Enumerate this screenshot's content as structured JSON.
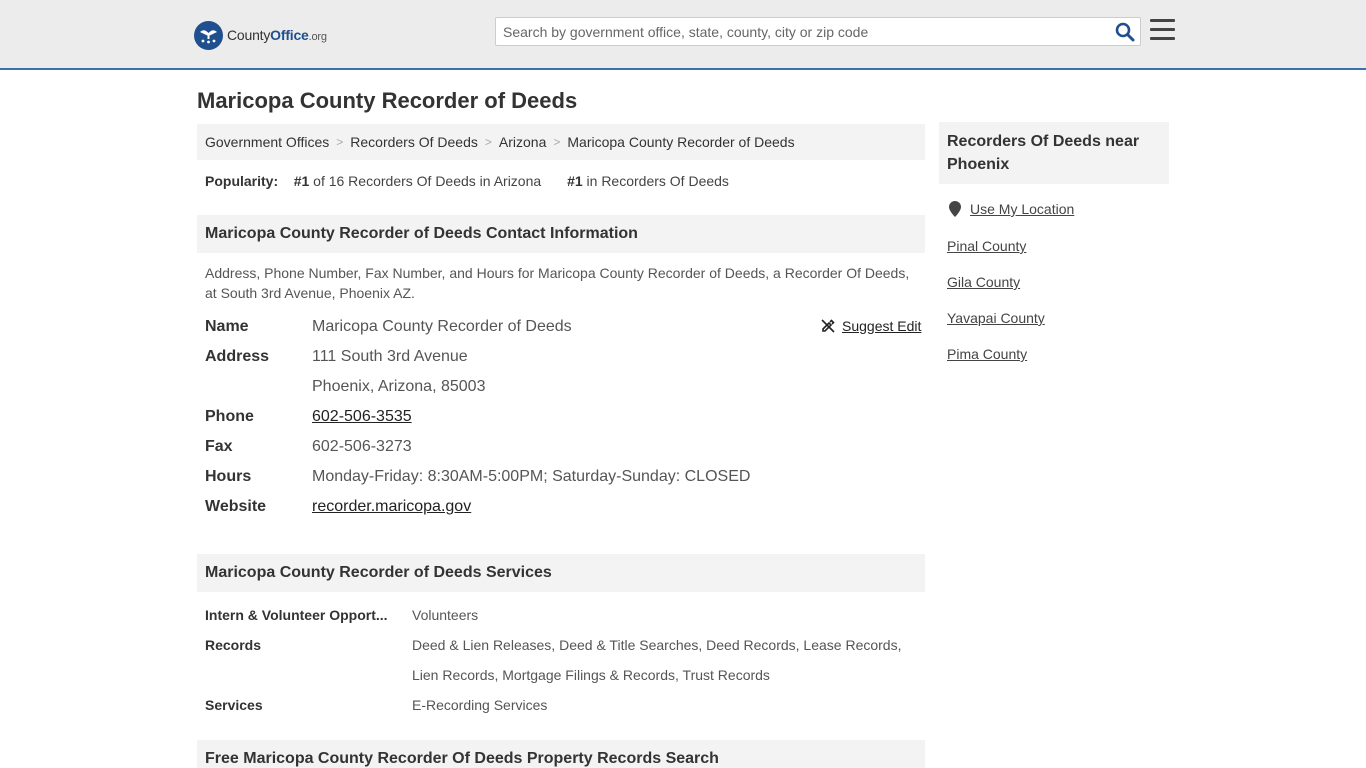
{
  "header": {
    "logo_county": "County",
    "logo_office": "Office",
    "logo_org": ".org",
    "search_placeholder": "Search by government office, state, county, city or zip code"
  },
  "page": {
    "title": "Maricopa County Recorder of Deeds",
    "breadcrumb": [
      "Government Offices",
      "Recorders Of Deeds",
      "Arizona",
      "Maricopa County Recorder of Deeds"
    ],
    "popularity_label": "Popularity:",
    "pop1_rank": "#1",
    "pop1_text": "of 16 Recorders Of Deeds in Arizona",
    "pop2_rank": "#1",
    "pop2_text": "in Recorders Of Deeds"
  },
  "contact": {
    "heading": "Maricopa County Recorder of Deeds Contact Information",
    "description": "Address, Phone Number, Fax Number, and Hours for Maricopa County Recorder of Deeds, a Recorder Of Deeds, at South 3rd Avenue, Phoenix AZ.",
    "suggest_edit": "Suggest Edit",
    "name_label": "Name",
    "name_value": "Maricopa County Recorder of Deeds",
    "address_label": "Address",
    "address_line1": "111 South 3rd Avenue",
    "address_line2": "Phoenix, Arizona, 85003",
    "phone_label": "Phone",
    "phone_value": "602-506-3535",
    "fax_label": "Fax",
    "fax_value": "602-506-3273",
    "hours_label": "Hours",
    "hours_value": "Monday-Friday: 8:30AM-5:00PM; Saturday-Sunday: CLOSED",
    "website_label": "Website",
    "website_value": "recorder.maricopa.gov"
  },
  "services": {
    "heading": "Maricopa County Recorder of Deeds Services",
    "rows": [
      {
        "label": "Intern & Volunteer Opport...",
        "value": "Volunteers"
      },
      {
        "label": "Records",
        "value": "Deed & Lien Releases, Deed & Title Searches, Deed Records, Lease Records,"
      },
      {
        "label": "",
        "value": "Lien Records, Mortgage Filings & Records, Trust Records"
      },
      {
        "label": "Services",
        "value": "E-Recording Services"
      }
    ]
  },
  "free_search": {
    "heading": "Free Maricopa County Recorder Of Deeds Property Records Search"
  },
  "sidebar": {
    "heading": "Recorders Of Deeds near Phoenix",
    "use_location": "Use My Location",
    "links": [
      "Pinal County",
      "Gila County",
      "Yavapai County",
      "Pima County"
    ]
  }
}
